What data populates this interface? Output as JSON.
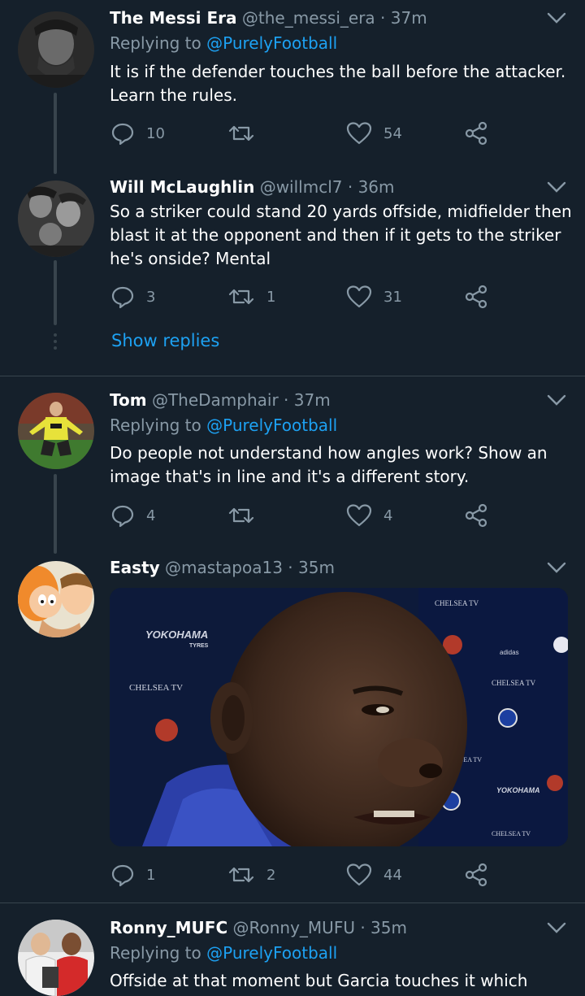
{
  "tweets": [
    {
      "name": "The Messi Era",
      "handle": "@the_messi_era",
      "time": "37m",
      "reply_prefix": "Replying to",
      "reply_to": "@PurelyFootball",
      "text": "It is if the defender touches the ball before the attacker. Learn the rules.",
      "replies": "10",
      "retweets": "",
      "likes": "54"
    },
    {
      "name": "Will McLaughlin",
      "handle": "@willmcl7",
      "time": "36m",
      "text": "So a striker could stand 20 yards offside, midfielder then blast it at the opponent and then if it gets to the striker he's onside? Mental",
      "replies": "3",
      "retweets": "1",
      "likes": "31"
    },
    {
      "name": "Tom",
      "handle": "@TheDamphair",
      "time": "37m",
      "reply_prefix": "Replying to",
      "reply_to": "@PurelyFootball",
      "text": "Do people not understand how angles work? Show an image that's in line and it's a different story.",
      "replies": "4",
      "retweets": "",
      "likes": "4"
    },
    {
      "name": "Easty",
      "handle": "@mastapoa13",
      "time": "35m",
      "replies": "1",
      "retweets": "2",
      "likes": "44"
    },
    {
      "name": "Ronny_MUFC",
      "handle": "@Ronny_MUFU",
      "time": "35m",
      "reply_prefix": "Replying to",
      "reply_to": "@PurelyFootball",
      "text": "Offside at that moment but Garcia touches it which"
    }
  ],
  "show_replies": "Show replies",
  "separator": "·",
  "media": {
    "backdrop_texts": [
      "YOKOHAMA",
      "TYRES",
      "CHELSEA TV",
      "CHELSEA TV",
      "CHELSEA TV",
      "CHELSEA TV",
      "adidas",
      "adidas",
      "YOKOHAMA",
      "CHELSEA TV"
    ]
  },
  "icons": {
    "reply": "reply-icon",
    "retweet": "retweet-icon",
    "like": "heart-icon",
    "share": "share-icon",
    "menu": "chevron-down-icon"
  },
  "colors": {
    "background": "#15202b",
    "text": "#ffffff",
    "secondary": "#8899a6",
    "accent": "#1da1f2",
    "border": "#38444d"
  }
}
